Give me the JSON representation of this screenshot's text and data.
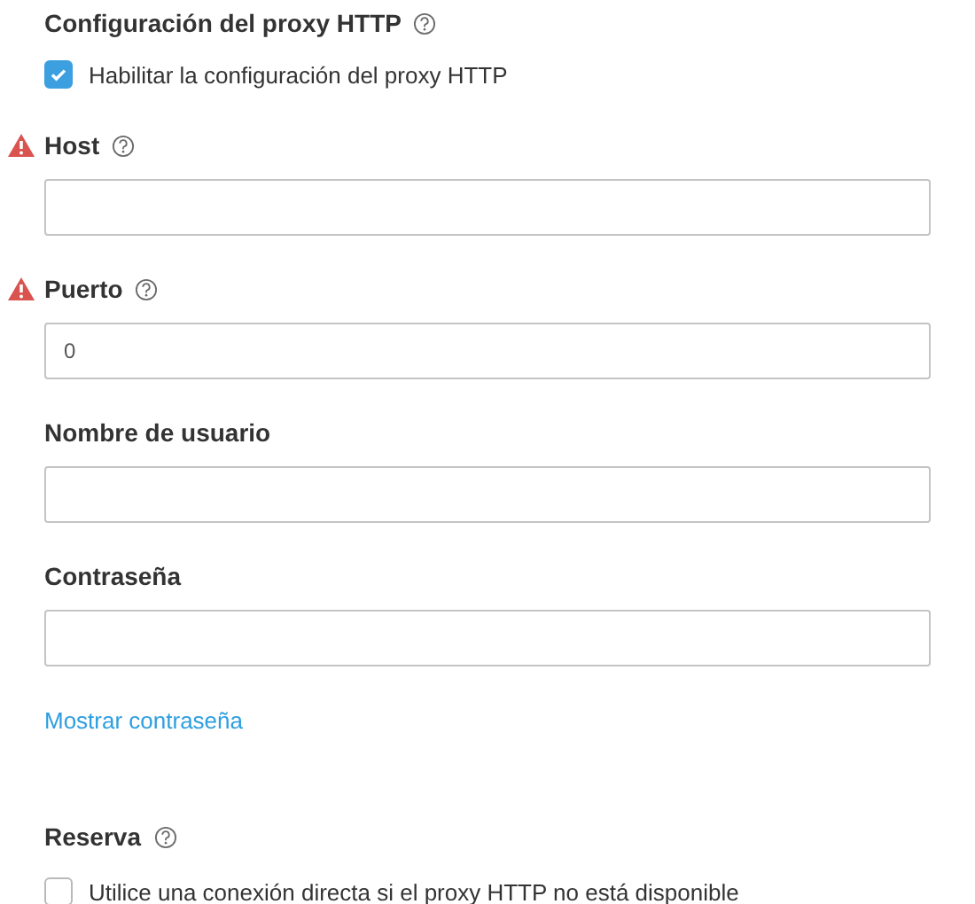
{
  "proxy": {
    "title": "Configuración del proxy HTTP",
    "help": true,
    "enable": {
      "label": "Habilitar la configuración del proxy HTTP",
      "checked": true
    }
  },
  "fields": [
    {
      "label": "Host",
      "warning": true,
      "help": true
    },
    {
      "label": "Puerto",
      "warning": true,
      "help": true,
      "value": "0"
    },
    {
      "label": "Nombre de usuario",
      "warning": false,
      "help": false
    },
    {
      "label": "Contraseña",
      "warning": false,
      "help": false
    }
  ],
  "show_password_link": "Mostrar contraseña",
  "fallback": {
    "title": "Reserva",
    "help": true,
    "option": {
      "label": "Utilice una conexión directa si el proxy HTTP no está disponible",
      "checked": false
    }
  }
}
